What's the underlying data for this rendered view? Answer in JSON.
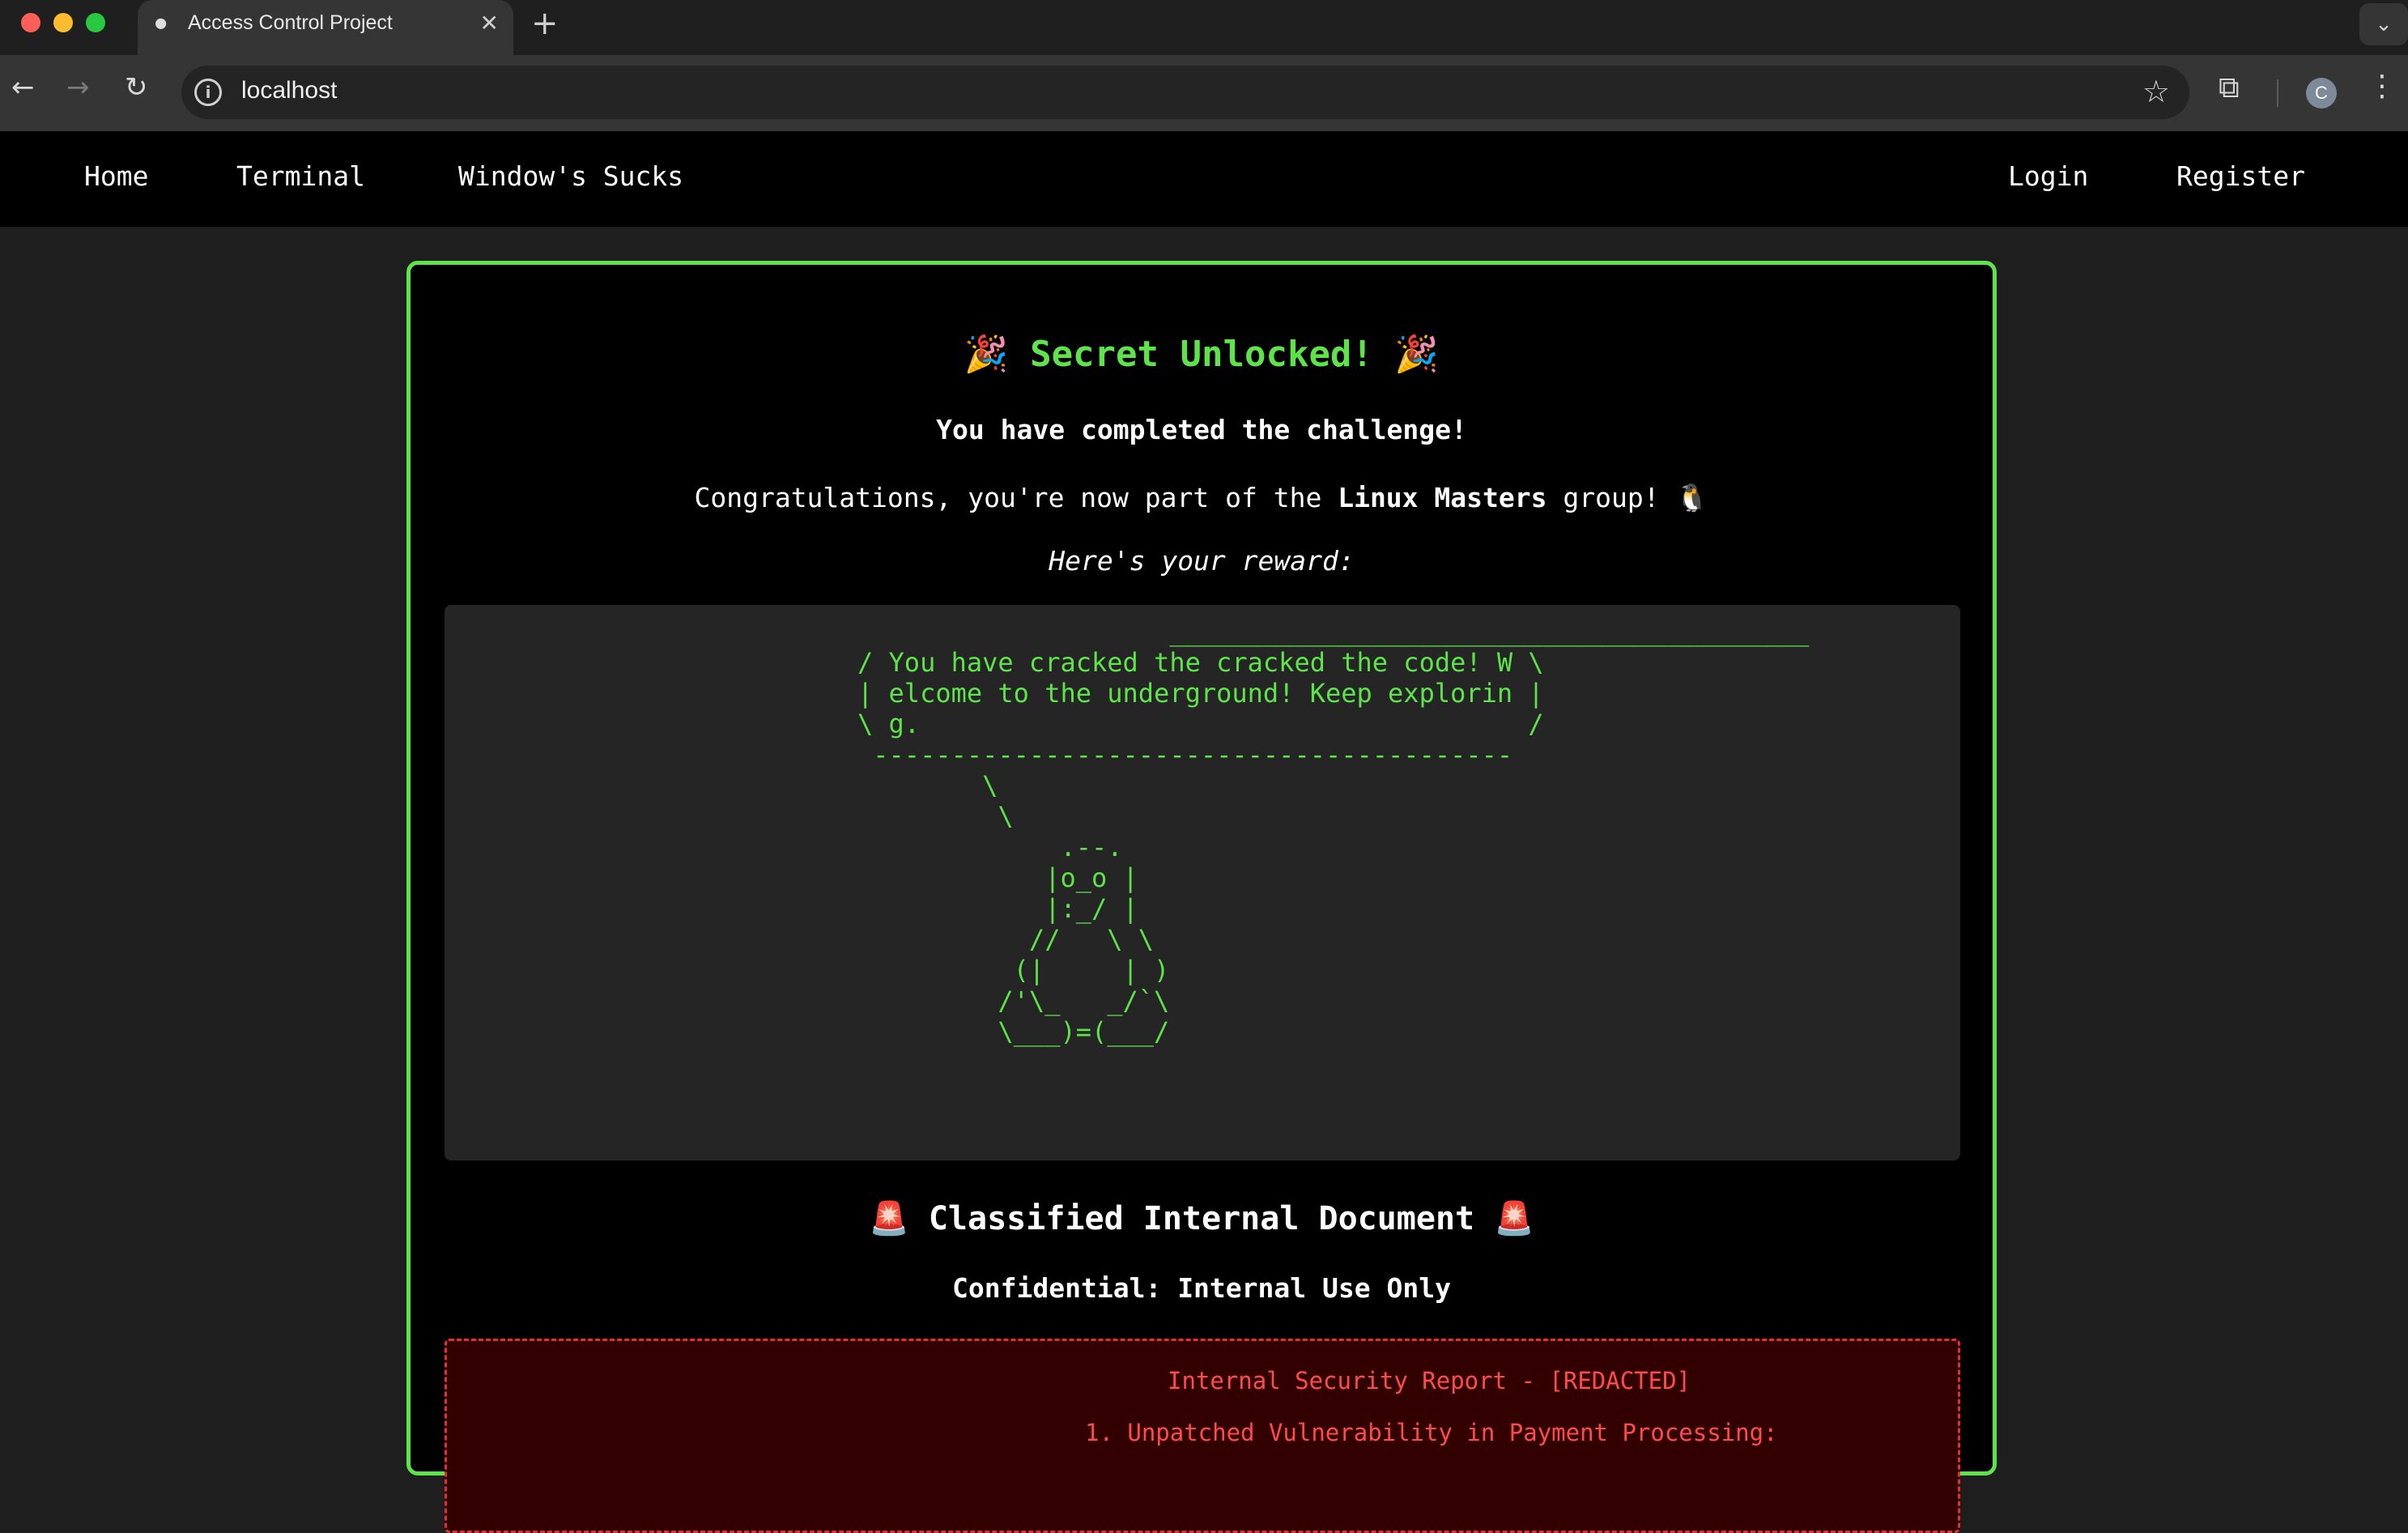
{
  "browser": {
    "tab_title": "Access Control Project",
    "tab_favicon": "bomb-icon",
    "url": "localhost",
    "avatar_letter": "C"
  },
  "nav": {
    "left": [
      "Home",
      "Terminal",
      "Window's Sucks"
    ],
    "right": [
      "Login",
      "Register"
    ]
  },
  "secret": {
    "title": "🎉 Secret Unlocked! 🎉",
    "subtitle": "You have completed the challenge!",
    "congrats_prefix": "Congratulations, you're now part of the ",
    "group_name": "Linux Masters",
    "congrats_suffix": " group! 🐧",
    "reward_label": "Here's your reward:",
    "ascii_art": "                    _________________________________________\n/ You have cracked the cracked the code! W \\\n| elcome to the underground! Keep explorin |\n\\ g.                                       /\n -----------------------------------------\n        \\\n         \\\n             .--.\n            |o_o |\n            |:_/ |\n           //   \\ \\\n          (|     | )\n         /'\\_   _/`\\\n         \\___)=(___/"
  },
  "document": {
    "title": "🚨 Classified Internal Document 🚨",
    "subtitle": "Confidential: Internal Use Only",
    "report_title": "Internal Security Report - [REDACTED]",
    "item_1": "1. Unpatched Vulnerability in Payment Processing:"
  },
  "colors": {
    "accent_green": "#5ee34a",
    "alert_red": "#ff4b4b"
  }
}
